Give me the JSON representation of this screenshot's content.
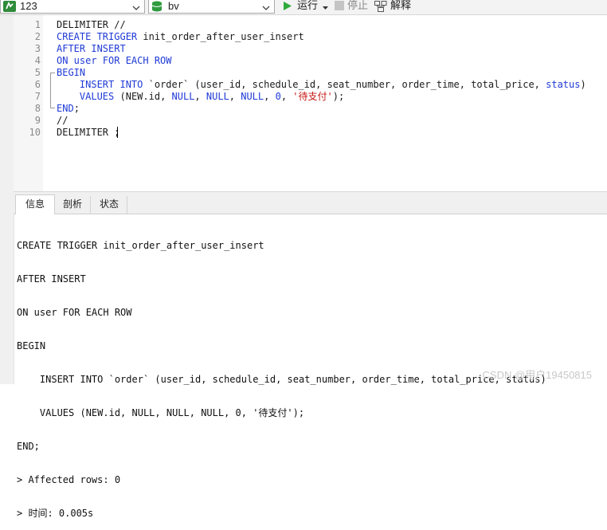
{
  "toolbar": {
    "connection": "123",
    "database": "bv",
    "run_label": "运行",
    "stop_label": "停止",
    "explain_label": "解释"
  },
  "editor": {
    "lines": [
      {
        "num": "1",
        "parts": [
          {
            "t": "DELIMITER //",
            "c": "plain"
          }
        ]
      },
      {
        "num": "2",
        "parts": [
          {
            "t": "CREATE TRIGGER",
            "c": "kw"
          },
          {
            "t": " init_order_after_user_insert",
            "c": "plain"
          }
        ]
      },
      {
        "num": "3",
        "parts": [
          {
            "t": "AFTER INSERT",
            "c": "kw"
          }
        ]
      },
      {
        "num": "4",
        "parts": [
          {
            "t": "ON",
            "c": "kw"
          },
          {
            "t": " user ",
            "c": "kw"
          },
          {
            "t": "FOR EACH ROW",
            "c": "kw"
          }
        ]
      },
      {
        "num": "5",
        "parts": [
          {
            "t": "BEGIN",
            "c": "kw"
          }
        ]
      },
      {
        "num": "6",
        "parts": [
          {
            "t": "    ",
            "c": "plain"
          },
          {
            "t": "INSERT INTO",
            "c": "kw"
          },
          {
            "t": " `order` (user_id, schedule_id, seat_number, order_time, total_price, ",
            "c": "plain"
          },
          {
            "t": "status",
            "c": "kw"
          },
          {
            "t": ")",
            "c": "plain"
          }
        ]
      },
      {
        "num": "7",
        "parts": [
          {
            "t": "    ",
            "c": "plain"
          },
          {
            "t": "VALUES",
            "c": "kw"
          },
          {
            "t": " (NEW.id, ",
            "c": "plain"
          },
          {
            "t": "NULL",
            "c": "kw"
          },
          {
            "t": ", ",
            "c": "plain"
          },
          {
            "t": "NULL",
            "c": "kw"
          },
          {
            "t": ", ",
            "c": "plain"
          },
          {
            "t": "NULL",
            "c": "kw"
          },
          {
            "t": ", ",
            "c": "plain"
          },
          {
            "t": "0",
            "c": "kw"
          },
          {
            "t": ", ",
            "c": "plain"
          },
          {
            "t": "'待支付'",
            "c": "str"
          },
          {
            "t": ");",
            "c": "plain"
          }
        ]
      },
      {
        "num": "8",
        "parts": [
          {
            "t": "END",
            "c": "kw"
          },
          {
            "t": ";",
            "c": "plain"
          }
        ]
      },
      {
        "num": "9",
        "parts": [
          {
            "t": "//",
            "c": "plain"
          }
        ]
      },
      {
        "num": "10",
        "parts": [
          {
            "t": "DELIMITER ;",
            "c": "plain"
          }
        ]
      }
    ]
  },
  "results": {
    "tabs": [
      {
        "label": "信息",
        "active": true
      },
      {
        "label": "剖析",
        "active": false
      },
      {
        "label": "状态",
        "active": false
      }
    ],
    "output_lines": [
      "CREATE TRIGGER init_order_after_user_insert",
      "AFTER INSERT",
      "ON user FOR EACH ROW",
      "BEGIN",
      "    INSERT INTO `order` (user_id, schedule_id, seat_number, order_time, total_price, status)",
      "    VALUES (NEW.id, NULL, NULL, NULL, 0, '待支付');",
      "END;",
      "> Affected rows: 0",
      "> 时间: 0.005s"
    ]
  },
  "watermark": "CSDN @用户19450815",
  "colors": {
    "keyword": "#1f3ad6",
    "string": "#c41a16",
    "line_number": "#8a8a8a"
  }
}
